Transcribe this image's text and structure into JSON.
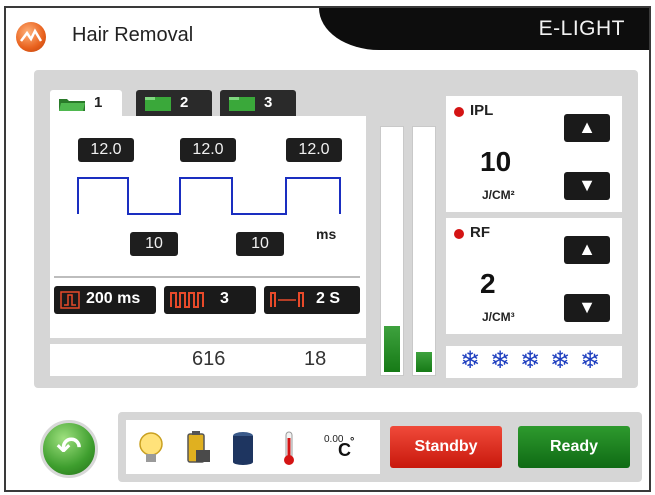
{
  "header": {
    "title": "Hair Removal",
    "brand": "E-LIGHT"
  },
  "tabs": [
    {
      "label": "1",
      "active": true
    },
    {
      "label": "2",
      "active": false
    },
    {
      "label": "3",
      "active": false
    }
  ],
  "waveform": {
    "pulse_widths": [
      "12.0",
      "12.0",
      "12.0"
    ],
    "delays": [
      "10",
      "10"
    ],
    "delay_unit": "ms"
  },
  "settings": {
    "pulse_duration": "200 ms",
    "pulse_count": "3",
    "interval_value": "2 S"
  },
  "counters": {
    "shots": "616",
    "sessions": "18"
  },
  "meters": {
    "left_level": 0.19,
    "right_level": 0.08
  },
  "ipl": {
    "label": "IPL",
    "value": "10",
    "unit": "J/CM²"
  },
  "rf": {
    "label": "RF",
    "value": "2",
    "unit": "J/CM³"
  },
  "cooling": {
    "level": 5,
    "symbol": "❄"
  },
  "status": {
    "icons": [
      "lamp-icon",
      "battery-icon",
      "water-tank-icon",
      "thermometer-icon"
    ],
    "temp_value": "0.00",
    "temp_unit": "C"
  },
  "actions": {
    "standby_label": "Standby",
    "ready_label": "Ready"
  },
  "colors": {
    "pulse_line": "#1a2ec0",
    "standby": "#e0281a",
    "ready": "#1a7e1a",
    "meter": "#1e861e",
    "indicator": "#d41414"
  }
}
